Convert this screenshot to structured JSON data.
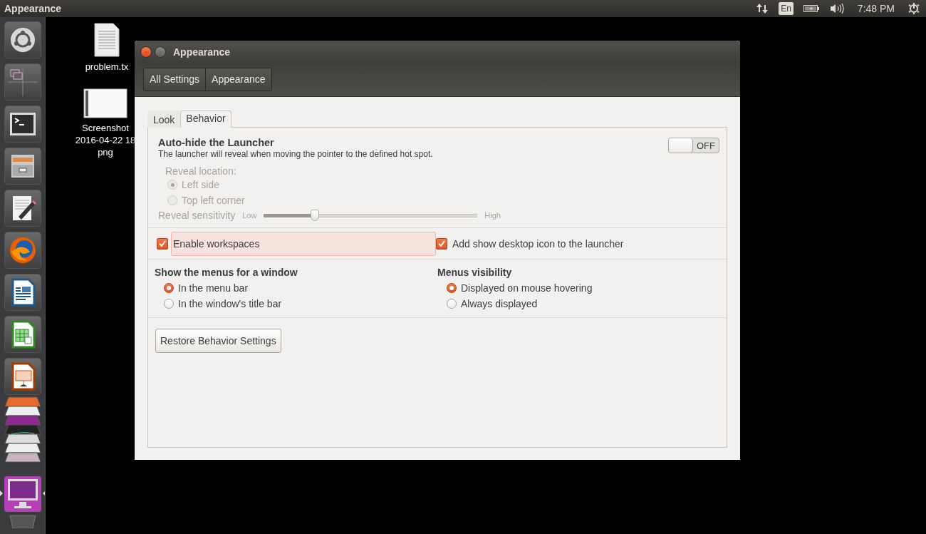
{
  "top_bar": {
    "app_title": "Appearance",
    "keyboard_layout": "En",
    "clock": "7:48 PM"
  },
  "desktop_icons": [
    {
      "kind": "text-file",
      "label_lines": [
        "problem.tx"
      ]
    },
    {
      "kind": "image-file",
      "label_lines": [
        "Screenshot",
        "2016-04-22 18",
        "png"
      ]
    }
  ],
  "window": {
    "title": "Appearance",
    "breadcrumbs": [
      "All Settings",
      "Appearance"
    ],
    "tabs": [
      {
        "label": "Look",
        "selected": false
      },
      {
        "label": "Behavior",
        "selected": true
      }
    ],
    "auto_hide": {
      "title": "Auto-hide the Launcher",
      "description": "The launcher will reveal when moving the pointer to the defined hot spot.",
      "toggle": {
        "on": false,
        "label": "OFF"
      }
    },
    "reveal": {
      "disabled": true,
      "location_label": "Reveal location:",
      "options": [
        {
          "label": "Left side",
          "selected": true
        },
        {
          "label": "Top left corner",
          "selected": false
        }
      ],
      "sensitivity": {
        "label": "Reveal sensitivity",
        "low": "Low",
        "high": "High",
        "level": 0.24
      }
    },
    "checkboxes": [
      {
        "label": "Enable workspaces",
        "checked": true,
        "hovered": true
      },
      {
        "label": "Add show desktop icon to the launcher",
        "checked": true,
        "hovered": false
      }
    ],
    "radio_groups": [
      {
        "title": "Show the menus for a window",
        "options": [
          {
            "label": "In the menu bar",
            "selected": true
          },
          {
            "label": "In the window's title bar",
            "selected": false
          }
        ]
      },
      {
        "title": "Menus visibility",
        "options": [
          {
            "label": "Displayed on mouse hovering",
            "selected": true
          },
          {
            "label": "Always displayed",
            "selected": false
          }
        ]
      }
    ],
    "restore_button": "Restore Behavior Settings"
  }
}
